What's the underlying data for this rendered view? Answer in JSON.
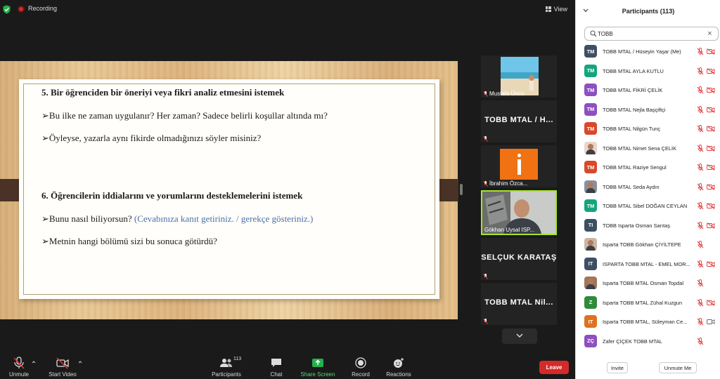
{
  "topbar": {
    "recording_label": "Recording",
    "view_label": "View"
  },
  "slide": {
    "line1": "5. Bir öğrenciden bir öneriyi veya fikri analiz etmesini istemek",
    "line2": "➢Bu ilke ne zaman uygulanır? Her zaman? Sadece belirli koşullar altında mı?",
    "line3": "➢Öyleyse, yazarla aynı fikirde olmadığınızı söyler misiniz?",
    "line4": "6. Öğrencilerin iddialarını ve yorumlarını desteklemelerini istemek",
    "line5_prefix": "➢Bunu nasıl biliyorsun?",
    "line5_blue": "(Cevabınıza kanıt getiriniz. / gerekçe gösteriniz.)",
    "line6": "➢Metnin hangi bölümü sizi bu sonuca götürdü?"
  },
  "thumbnails": [
    {
      "name": "Mustafa Üncü",
      "big": ""
    },
    {
      "name": "",
      "big": "TOBB MTAL / H..."
    },
    {
      "name": "İbrahim Özca...",
      "big": ""
    },
    {
      "name": "Gökhan Uysal ISP...",
      "big": ""
    },
    {
      "name": "",
      "big": "SELÇUK KARATAŞ"
    },
    {
      "name": "",
      "big": "TOBB MTAL Nil..."
    }
  ],
  "toolbar": {
    "unmute": "Unmute",
    "start_video": "Start Video",
    "participants": "Participants",
    "participants_count": "113",
    "chat": "Chat",
    "share_screen": "Share Screen",
    "record": "Record",
    "reactions": "Reactions",
    "leave": "Leave"
  },
  "panel": {
    "title": "Participants (113)",
    "search_value": "TOBB",
    "invite": "Invite",
    "unmute_me": "Unmute Me"
  },
  "participants": [
    {
      "initials": "TM",
      "name": "TOBB MTAL / Hüseyin Yaşar (Me)",
      "color": "#3d4f63"
    },
    {
      "initials": "TM",
      "name": "TOBB MTAL AYLA KUTLU",
      "color": "#15a57e"
    },
    {
      "initials": "TM",
      "name": "TOBB MTAL FİKRİ ÇELİK",
      "color": "#8e4fc0"
    },
    {
      "initials": "TM",
      "name": "TOBB MTAL Nejla Başçiftçi",
      "color": "#8e4fc0"
    },
    {
      "initials": "TM",
      "name": "TOBB MTAL Nilgün Tunç",
      "color": "#d9482b"
    },
    {
      "initials": "",
      "name": "TOBB MTAL Nimet Sena ÇELİK",
      "color": "#e8d6c8"
    },
    {
      "initials": "TM",
      "name": "TOBB MTAL Raziye Sengul",
      "color": "#d9482b"
    },
    {
      "initials": "",
      "name": "TOBB MTAL Seda Aydın",
      "color": "#8a8f9a"
    },
    {
      "initials": "TM",
      "name": "TOBB MTAL Sibel DOĞAN CEYLAN",
      "color": "#15a57e"
    },
    {
      "initials": "TI",
      "name": "TOBB Isparta Osman Sarıtaş",
      "color": "#3d4f63"
    },
    {
      "initials": "",
      "name": "Isparta TOBB Gökhan ÇİYİLTEPE",
      "color": "#c9b7a6"
    },
    {
      "initials": "IT",
      "name": "ISPARTA TOBB MTAL - EMEL MOR...",
      "color": "#3d4f63"
    },
    {
      "initials": "",
      "name": "Isparta TOBB MTAL Osman Topdal",
      "color": "#a0765a"
    },
    {
      "initials": "Z",
      "name": "Isparta TOBB MTAL Zühal Kuzgun",
      "color": "#2e8b3a"
    },
    {
      "initials": "IT",
      "name": "Isparta TOBB MTAL, Süleyman Ce...",
      "color": "#e0711f"
    },
    {
      "initials": "ZÇ",
      "name": "Zafer ÇİÇEK TOBB MTAL",
      "color": "#8e4fc0"
    }
  ]
}
